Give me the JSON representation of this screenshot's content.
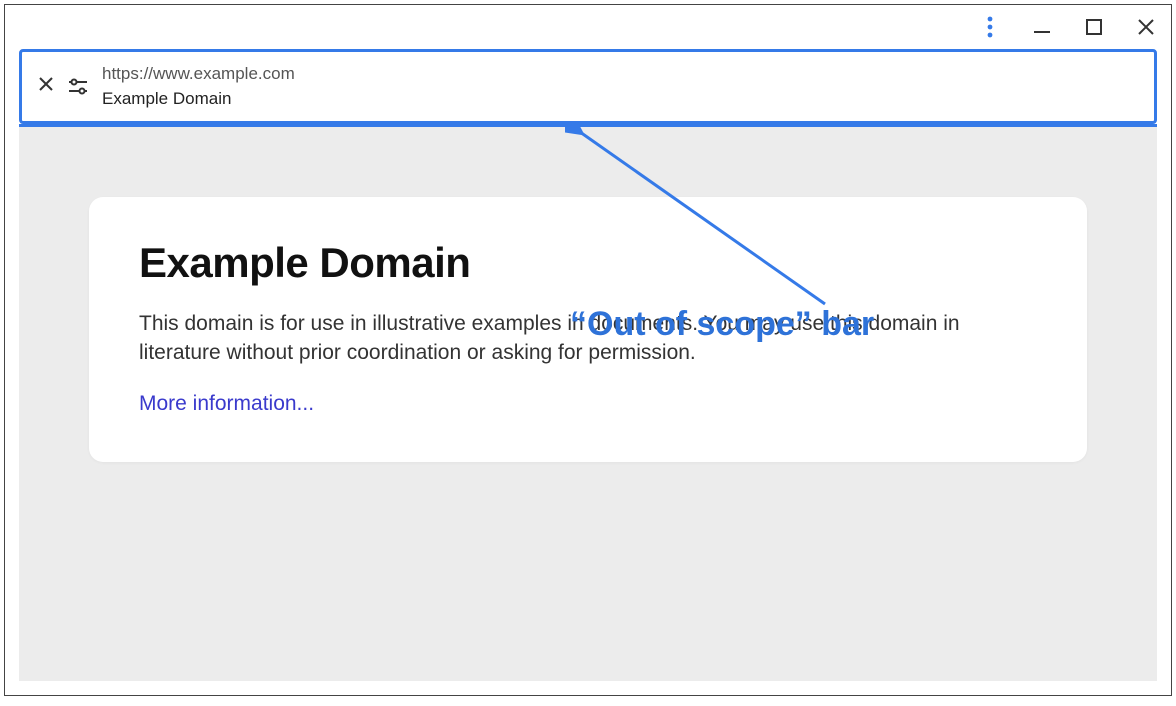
{
  "addressBar": {
    "url": "https://www.example.com",
    "title": "Example Domain"
  },
  "page": {
    "heading": "Example Domain",
    "body": "This domain is for use in illustrative examples in documents. You may use this domain in literature without prior coordination or asking for permission.",
    "link": "More information..."
  },
  "annotation": {
    "label": "“Out of scope” bar"
  }
}
